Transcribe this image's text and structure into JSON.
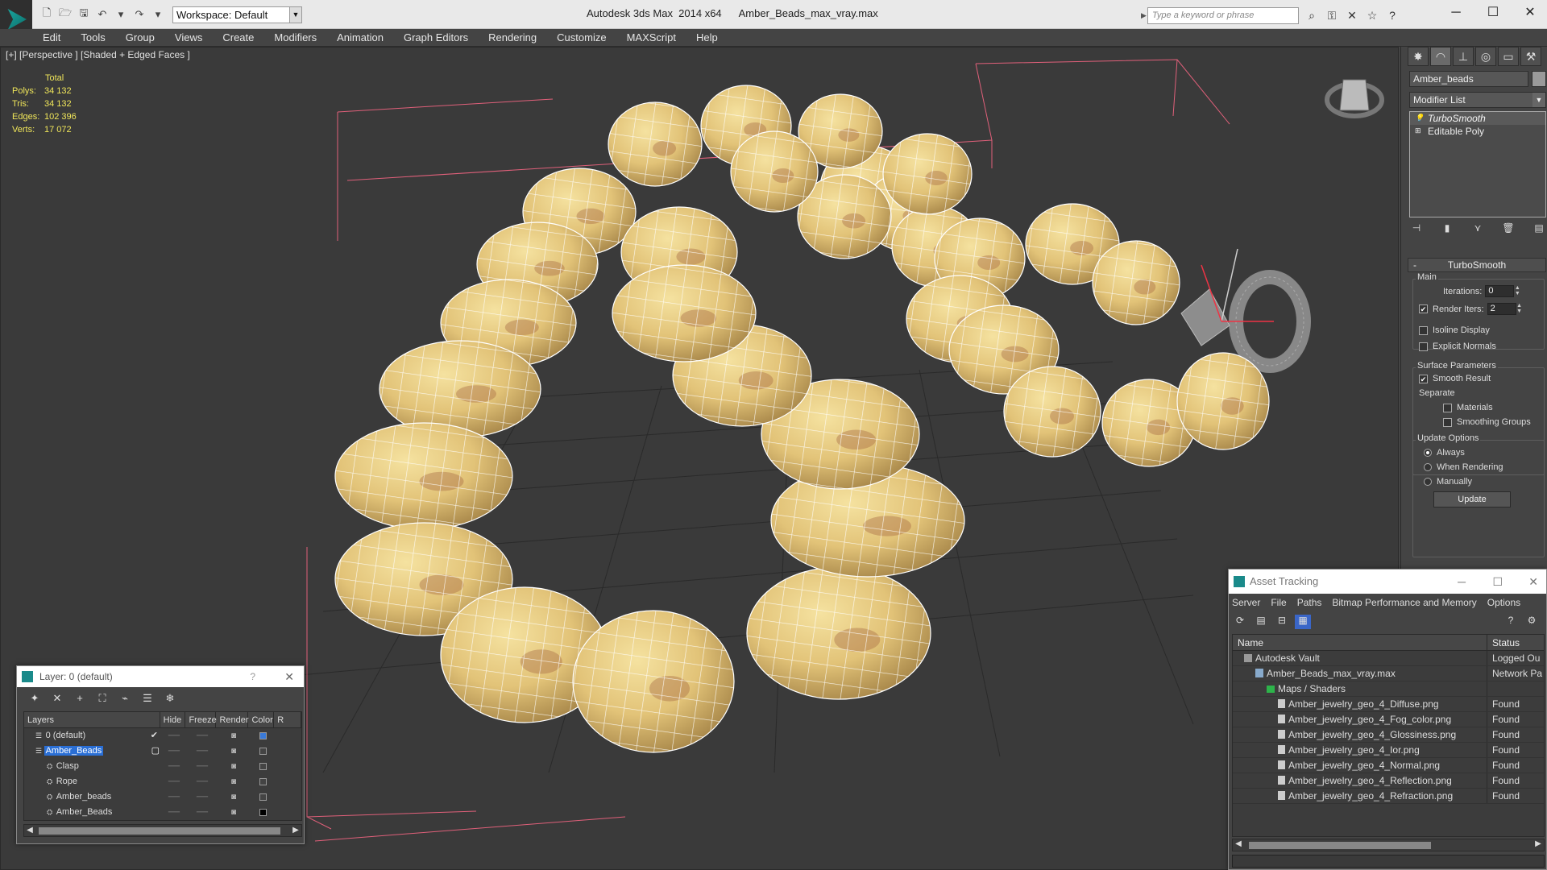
{
  "titlebar": {
    "workspace_label": "Workspace: Default",
    "app_title": "Autodesk 3ds Max  2014 x64      Amber_Beads_max_vray.max",
    "search_placeholder": "Type a keyword or phrase"
  },
  "menu": {
    "items": [
      "Edit",
      "Tools",
      "Group",
      "Views",
      "Create",
      "Modifiers",
      "Animation",
      "Graph Editors",
      "Rendering",
      "Customize",
      "MAXScript",
      "Help"
    ]
  },
  "viewport": {
    "label": "[+] [Perspective ] [Shaded + Edged Faces ]",
    "stats": {
      "header": "Total",
      "rows": [
        {
          "key": "Polys:",
          "value": "34 132"
        },
        {
          "key": "Tris:",
          "value": "34 132"
        },
        {
          "key": "Edges:",
          "value": "102 396"
        },
        {
          "key": "Verts:",
          "value": "17 072"
        }
      ]
    }
  },
  "command_panel": {
    "object_name": "Amber_beads",
    "modifier_list": "Modifier List",
    "stack": [
      "TurboSmooth",
      "Editable Poly"
    ],
    "rollout_title": "TurboSmooth",
    "main_label": "Main",
    "iterations_label": "Iterations:",
    "iterations_value": "0",
    "render_iters_label": "Render Iters:",
    "render_iters_value": "2",
    "isoline_label": "Isoline Display",
    "explicit_normals_label": "Explicit Normals",
    "surface_params_label": "Surface Parameters",
    "smooth_result_label": "Smooth Result",
    "separate_label": "Separate",
    "materials_label": "Materials",
    "smoothing_groups_label": "Smoothing Groups",
    "update_options_label": "Update Options",
    "always_label": "Always",
    "when_rendering_label": "When Rendering",
    "manually_label": "Manually",
    "update_button": "Update"
  },
  "layer_dialog": {
    "title": "Layer: 0 (default)",
    "help": "?",
    "columns": [
      "Layers",
      "Hide",
      "Freeze",
      "Render",
      "Color",
      "R"
    ],
    "rows": [
      {
        "name": "0 (default)",
        "indent": 1,
        "color": "#3a7ad8",
        "selected": false,
        "active": true
      },
      {
        "name": "Amber_Beads",
        "indent": 1,
        "color": "#444444",
        "selected": true,
        "active": false
      },
      {
        "name": "Clasp",
        "indent": 2,
        "color": "#444444",
        "selected": false,
        "active": false
      },
      {
        "name": "Rope",
        "indent": 2,
        "color": "#444444",
        "selected": false,
        "active": false
      },
      {
        "name": "Amber_beads",
        "indent": 2,
        "color": "#444444",
        "selected": false,
        "active": false
      },
      {
        "name": "Amber_Beads",
        "indent": 2,
        "color": "#000000",
        "selected": false,
        "active": false
      }
    ]
  },
  "asset_dialog": {
    "title": "Asset Tracking",
    "menu": [
      "Server",
      "File",
      "Paths",
      "Bitmap Performance and Memory",
      "Options"
    ],
    "columns": {
      "name": "Name",
      "status": "Status"
    },
    "rows": [
      {
        "name": "Autodesk Vault",
        "status": "Logged Ou",
        "indent": 1,
        "icon": "vault"
      },
      {
        "name": "Amber_Beads_max_vray.max",
        "status": "Network Pa",
        "indent": 2,
        "icon": "max"
      },
      {
        "name": "Maps / Shaders",
        "status": "",
        "indent": 3,
        "icon": "folder"
      },
      {
        "name": "Amber_jewelry_geo_4_Diffuse.png",
        "status": "Found",
        "indent": 4,
        "icon": "file"
      },
      {
        "name": "Amber_jewelry_geo_4_Fog_color.png",
        "status": "Found",
        "indent": 4,
        "icon": "file"
      },
      {
        "name": "Amber_jewelry_geo_4_Glossiness.png",
        "status": "Found",
        "indent": 4,
        "icon": "file"
      },
      {
        "name": "Amber_jewelry_geo_4_Ior.png",
        "status": "Found",
        "indent": 4,
        "icon": "file"
      },
      {
        "name": "Amber_jewelry_geo_4_Normal.png",
        "status": "Found",
        "indent": 4,
        "icon": "file"
      },
      {
        "name": "Amber_jewelry_geo_4_Reflection.png",
        "status": "Found",
        "indent": 4,
        "icon": "file"
      },
      {
        "name": "Amber_jewelry_geo_4_Refraction.png",
        "status": "Found",
        "indent": 4,
        "icon": "file"
      }
    ]
  }
}
